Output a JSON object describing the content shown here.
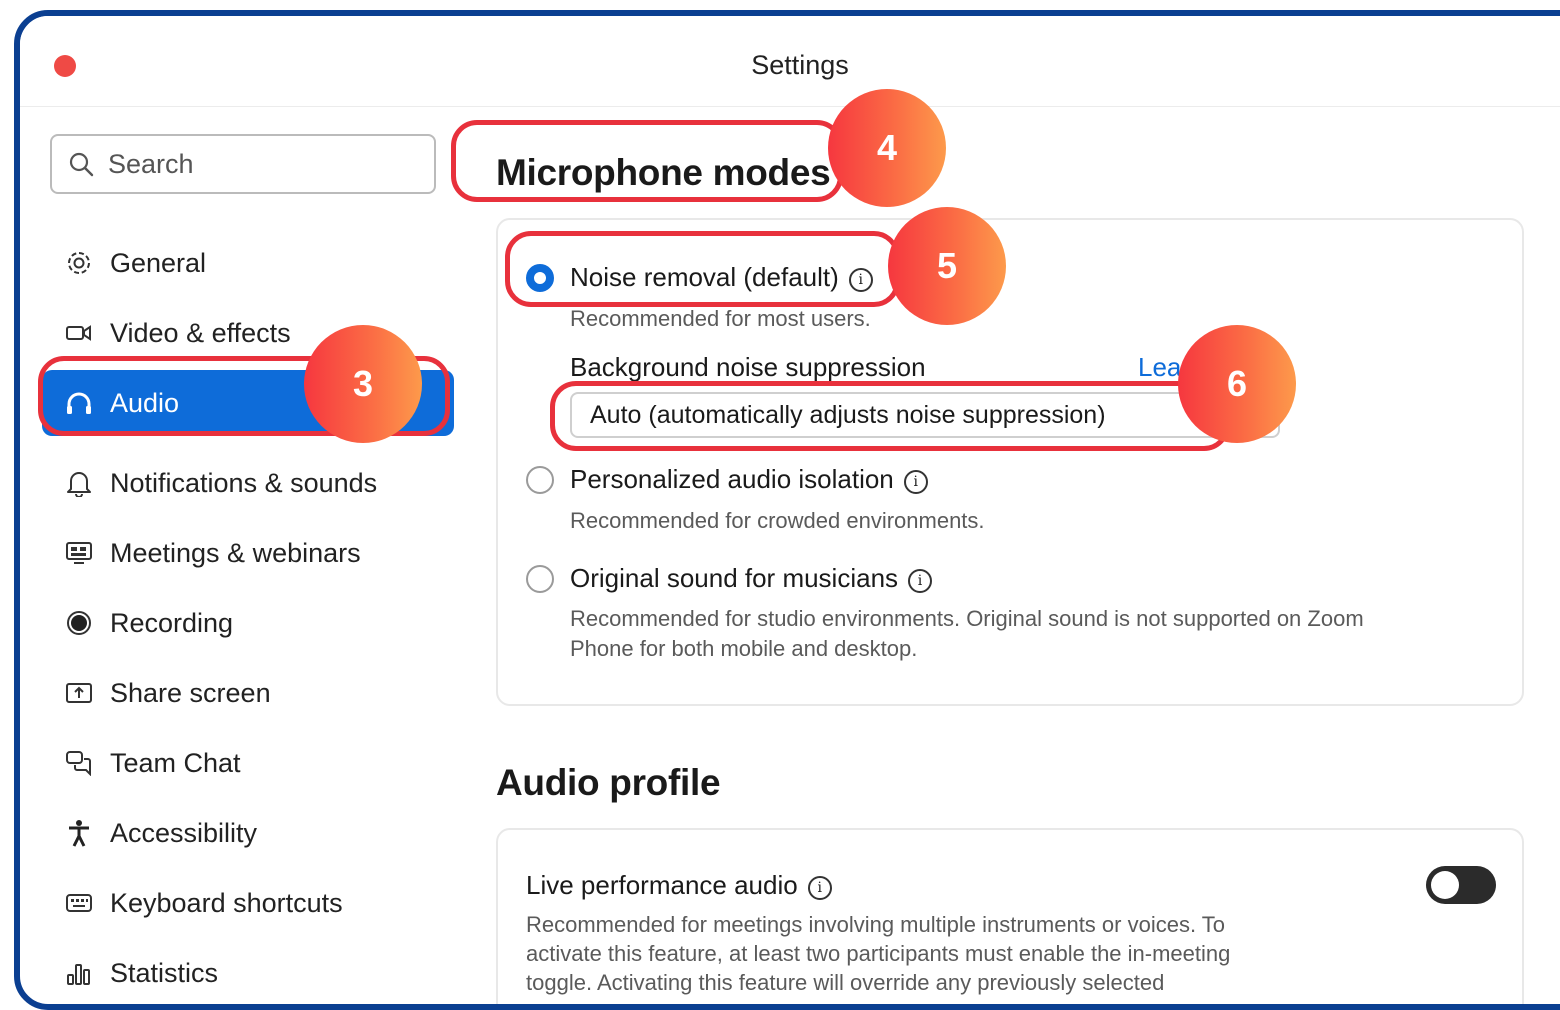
{
  "window": {
    "title": "Settings"
  },
  "search": {
    "placeholder": "Search"
  },
  "sidebar": {
    "items": [
      {
        "label": "General",
        "icon": "gear-icon"
      },
      {
        "label": "Video & effects",
        "icon": "video-camera-icon"
      },
      {
        "label": "Audio",
        "icon": "headphones-icon",
        "active": true
      },
      {
        "label": "Notifications & sounds",
        "icon": "bell-icon"
      },
      {
        "label": "Meetings & webinars",
        "icon": "meetings-icon"
      },
      {
        "label": "Recording",
        "icon": "record-icon"
      },
      {
        "label": "Share screen",
        "icon": "share-screen-icon"
      },
      {
        "label": "Team Chat",
        "icon": "chat-icon"
      },
      {
        "label": "Accessibility",
        "icon": "accessibility-icon"
      },
      {
        "label": "Keyboard shortcuts",
        "icon": "keyboard-icon"
      },
      {
        "label": "Statistics",
        "icon": "statistics-icon"
      }
    ]
  },
  "mic_modes": {
    "heading": "Microphone modes",
    "noise_removal": {
      "label": "Noise removal (default)",
      "description": "Recommended for most users.",
      "selected": true
    },
    "suppression": {
      "label": "Background noise suppression",
      "link": "Lear",
      "value": "Auto (automatically adjusts noise suppression)"
    },
    "isolation": {
      "label": "Personalized audio isolation",
      "description": "Recommended for crowded environments.",
      "selected": false
    },
    "original_sound": {
      "label": "Original sound for musicians",
      "description_line1": "Recommended for studio environments. Original sound is not supported on Zoom",
      "description_line2": "Phone for both mobile and desktop.",
      "selected": false
    }
  },
  "audio_profile": {
    "heading": "Audio profile",
    "live_performance": {
      "label": "Live performance audio",
      "description_line1": "Recommended for meetings involving multiple instruments or voices. To",
      "description_line2": "activate this feature, at least two participants must enable the in-meeting",
      "description_line3": "toggle. Activating this feature will override any previously selected",
      "enabled": false
    }
  },
  "annotations": {
    "badge3": "3",
    "badge4": "4",
    "badge5": "5",
    "badge6": "6"
  },
  "colors": {
    "accent": "#0e6cd9",
    "highlight": "#e8313c",
    "frame": "#0b3f91",
    "close": "#ef4a45"
  }
}
